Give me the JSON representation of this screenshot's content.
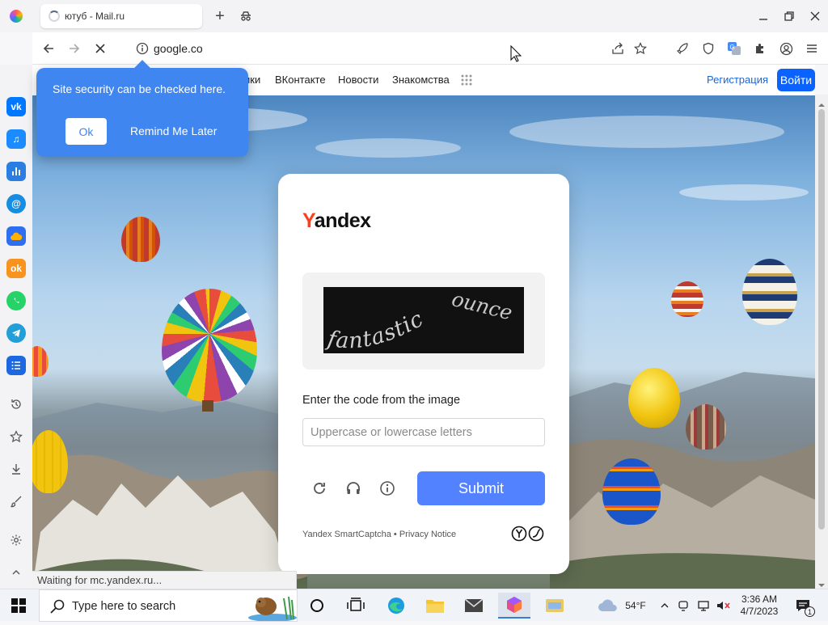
{
  "browser": {
    "tab": {
      "title": "ютуб - Mail.ru"
    },
    "address": {
      "url": "google.co"
    }
  },
  "yandex_nav": {
    "partial_link": "ики",
    "links": [
      "ВКонтакте",
      "Новости",
      "Знакомства"
    ],
    "register": "Регистрация",
    "login": "Войти"
  },
  "security_popup": {
    "message": "Site security can be checked here.",
    "ok": "Ok",
    "remind": "Remind Me Later"
  },
  "captcha": {
    "logo_first": "Y",
    "logo_rest": "andex",
    "captcha_words": [
      "fantastic",
      "ounce"
    ],
    "prompt": "Enter the code from the image",
    "input_placeholder": "Uppercase or lowercase letters",
    "submit": "Submit",
    "footer_product": "Yandex SmartCaptcha",
    "footer_separator": "•",
    "footer_privacy": "Privacy Notice"
  },
  "status_bar": {
    "text": "Waiting for mc.yandex.ru..."
  },
  "taskbar": {
    "search_placeholder": "Type here to search",
    "weather": "54°F",
    "time": "3:36 AM",
    "date": "4/7/2023",
    "notification_count": "1"
  },
  "colors": {
    "yandex_red": "#fc3f1d",
    "submit_blue": "#5282ff",
    "popup_blue": "#3f86f0",
    "login_blue": "#0a63ff"
  }
}
